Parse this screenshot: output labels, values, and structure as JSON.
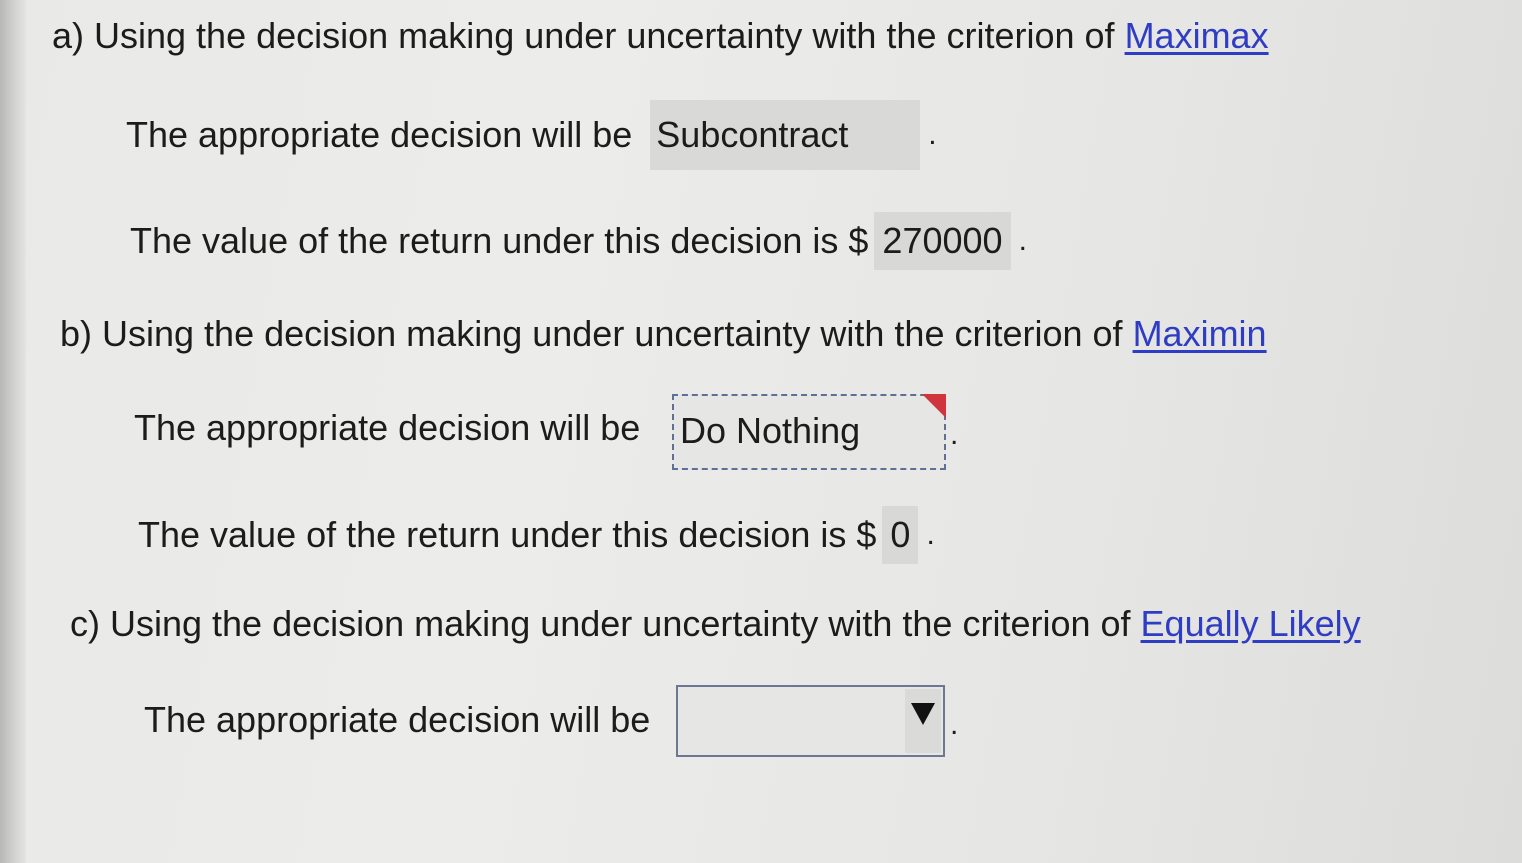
{
  "questions": {
    "a": {
      "prefix": "a) Using the decision making under uncertainty with the criterion of",
      "criterion": "Maximax",
      "decision_label": "The appropriate decision will be",
      "decision_value": "Subcontract",
      "value_label": "The value of the return under this decision is $",
      "value": "270000",
      "period": "."
    },
    "b": {
      "prefix": "b) Using the decision making under uncertainty with the criterion of",
      "criterion": "Maximin",
      "decision_label": "The appropriate decision will be",
      "decision_value": "Do Nothing",
      "value_label": "The value of the return under this decision is $",
      "value": "0",
      "period": "."
    },
    "c": {
      "prefix": "c) Using the decision making under uncertainty with the criterion of",
      "criterion": "Equally Likely",
      "decision_label": "The appropriate decision will be",
      "decision_value": "",
      "period": "."
    }
  },
  "colors": {
    "link": "#2f3dc4",
    "incorrect_flag": "#d0343c",
    "answer_cell_bg": "#d9d9d7"
  },
  "icons": {
    "dropdown": "triangle-down-icon",
    "incorrect": "red-corner-flag-icon"
  }
}
